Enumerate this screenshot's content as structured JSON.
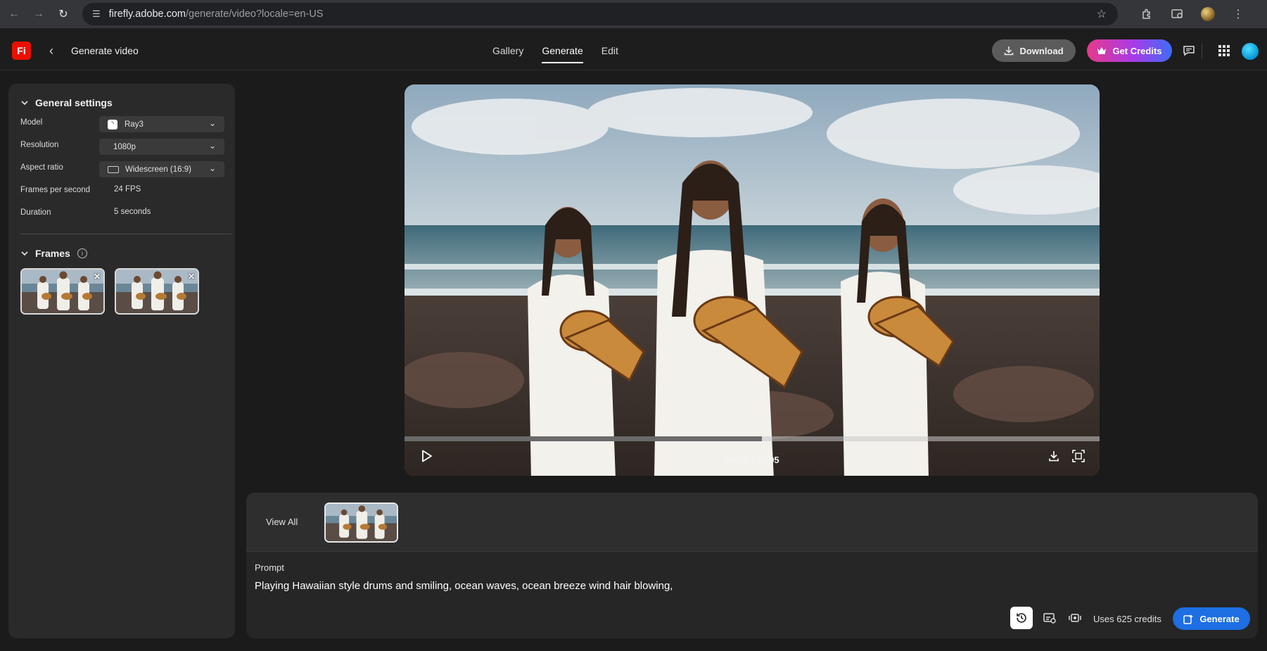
{
  "browser": {
    "url_host": "firefly.adobe.com",
    "url_path": "/generate/video?locale=en-US"
  },
  "header": {
    "logo": "Fi",
    "title": "Generate video",
    "tabs": [
      {
        "label": "Gallery",
        "selected": false
      },
      {
        "label": "Generate",
        "selected": true
      },
      {
        "label": "Edit",
        "selected": false
      }
    ],
    "download_label": "Download",
    "credits_label": "Get Credits",
    "colors": {
      "logo": "#eb1000",
      "credits_gradient_start": "#e63a8a",
      "credits_gradient_end": "#3d6df5"
    }
  },
  "settings": {
    "general_title": "General settings",
    "model_label": "Model",
    "model_value": "Ray3",
    "resolution_label": "Resolution",
    "resolution_value": "1080p",
    "aspect_label": "Aspect ratio",
    "aspect_value": "Widescreen (16:9)",
    "fps_label": "Frames per second",
    "fps_value": "24 FPS",
    "duration_label": "Duration",
    "duration_value": "5 seconds",
    "frames_title": "Frames"
  },
  "video": {
    "timecode": "00:02 / 00:05",
    "progress_fraction": 0.514
  },
  "prompt_panel": {
    "view_all": "View All",
    "prompt_label": "Prompt",
    "prompt_text": "Playing Hawaiian style drums and smiling, ocean waves, ocean breeze wind hair blowing,",
    "credits_text": "Uses 625 credits",
    "generate_label": "Generate",
    "colors": {
      "generate": "#1d6fe3"
    }
  }
}
